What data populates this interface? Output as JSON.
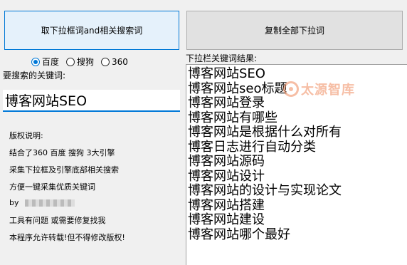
{
  "buttons": {
    "fetch": "取下拉框词and相关搜索词",
    "copy": "复制全部下拉词"
  },
  "engines": [
    {
      "label": "百度",
      "checked": true
    },
    {
      "label": "搜狗",
      "checked": false
    },
    {
      "label": "360",
      "checked": false
    }
  ],
  "search": {
    "label": "要搜索的关键词:",
    "value": "博客网站SEO"
  },
  "info": {
    "title": "版权说明:",
    "line1": "结合了360 百度 搜狗  3大引擎",
    "line2": "采集下拉框及引擎底部相关搜索",
    "line3": "方便一键采集优质关键词",
    "line4": "by",
    "line5": "工具有问题 或需要修复找我",
    "line6": "本程序允许转载!但不得修改版权!"
  },
  "results": {
    "label": "下拉栏关键词结果:",
    "items": [
      "博客网站SEO",
      "博客网站seo标题",
      "博客网站登录",
      "博客网站有哪些",
      "博客网站是根据什么对所有",
      "博客日志进行自动分类",
      "博客网站源码",
      "博客网站设计",
      "博客网站的设计与实现论文",
      "博客网站搭建",
      "博客网站建设",
      "博客网站哪个最好"
    ]
  },
  "watermark": {
    "text": "太源智库"
  }
}
